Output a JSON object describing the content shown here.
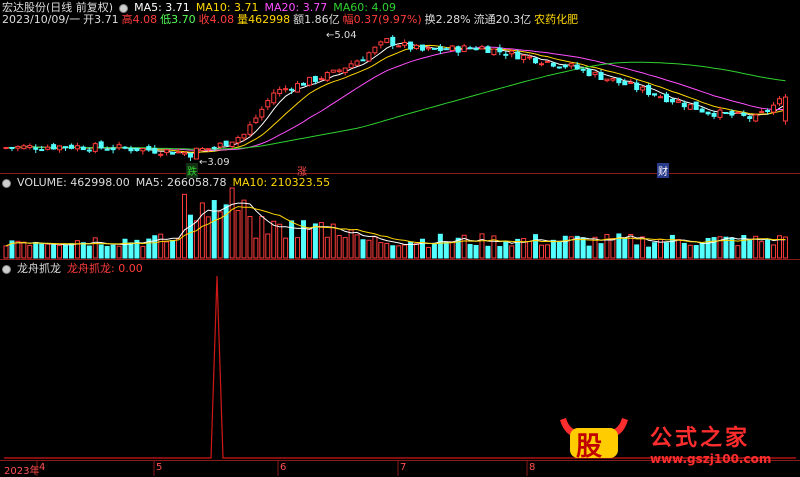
{
  "header": {
    "stock_name": "宏达股份(日线 前复权)",
    "ma5": "MA5: 3.71",
    "ma10": "MA10: 3.71",
    "ma20": "MA20: 3.77",
    "ma60": "MA60: 4.09"
  },
  "quote": {
    "date": "2023/10/09/一",
    "open": "开3.71",
    "high": "高4.08",
    "low": "低3.70",
    "close": "收4.08",
    "volume": "量462998",
    "amount": "额1.86亿",
    "change": "幅0.37(9.97%)",
    "turnover": "换2.28%",
    "float_cap": "流通20.3亿",
    "sector": "农药化肥"
  },
  "annotations": {
    "high_price": "5.04",
    "low_price": "3.09",
    "badge_drop": "跌",
    "badge_rise": "涨",
    "badge_finance": "财"
  },
  "volume_panel": {
    "volume": "VOLUME: 462998.00",
    "ma5": "MA5: 266058.78",
    "ma10": "MA10: 210323.55"
  },
  "indicator_panel": {
    "name": "龙舟抓龙",
    "series_label": "龙舟抓龙: 0.00"
  },
  "x_axis": {
    "labels": [
      "2023年",
      "4",
      "5",
      "6",
      "7",
      "8"
    ]
  },
  "watermark": {
    "logo_text": "股",
    "title": "公式之家",
    "url": "www.gszj100.com"
  },
  "colors": {
    "up": "#ff3c3c",
    "down": "#54ffff",
    "ma5": "#ffffff",
    "ma10": "#ffd700",
    "ma20": "#ff4fff",
    "ma60": "#2fd12f",
    "separator": "#8b1a1a"
  }
}
